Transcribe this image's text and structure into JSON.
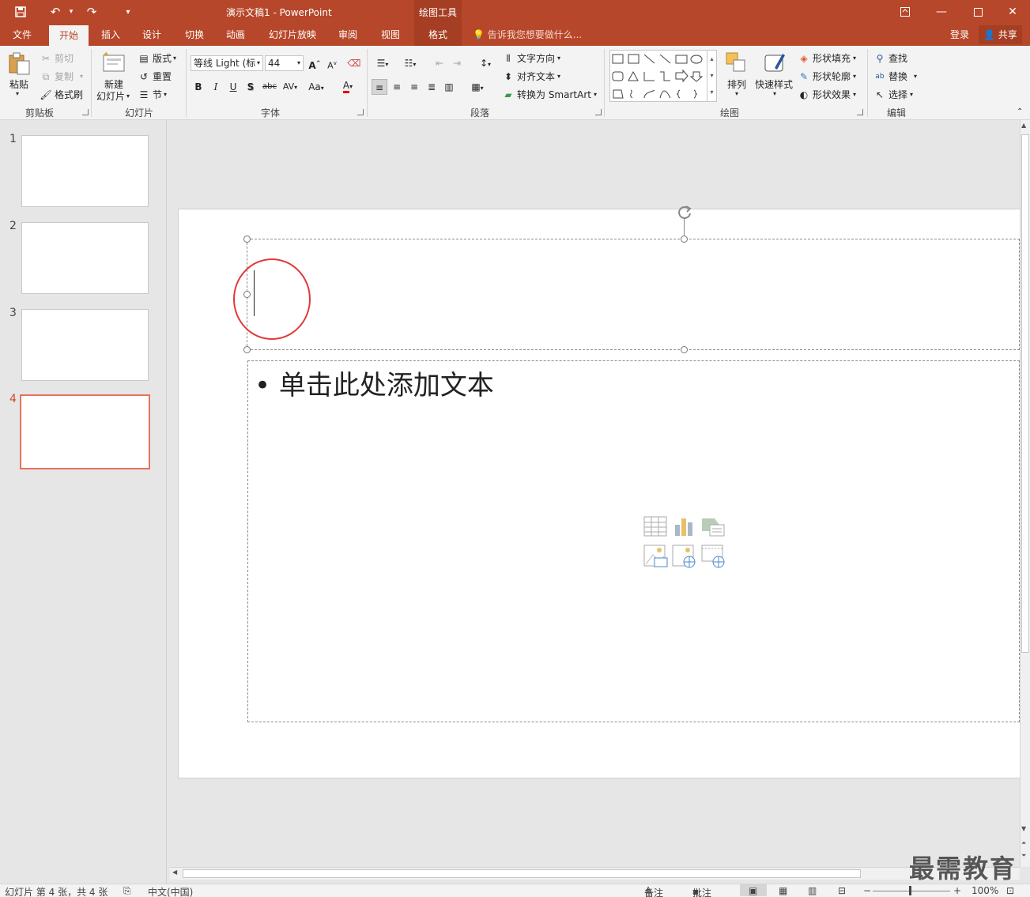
{
  "window": {
    "title": "演示文稿1 - PowerPoint",
    "context_tools": "绘图工具"
  },
  "tabs": {
    "file": "文件",
    "home": "开始",
    "insert": "插入",
    "design": "设计",
    "transitions": "切换",
    "animations": "动画",
    "slideshow": "幻灯片放映",
    "review": "审阅",
    "view": "视图",
    "format": "格式",
    "tell_me": "告诉我您想要做什么...",
    "login": "登录",
    "share": "共享"
  },
  "ribbon": {
    "clipboard": {
      "label": "剪贴板",
      "paste": "粘贴",
      "cut": "剪切",
      "copy": "复制",
      "format_painter": "格式刷"
    },
    "slides": {
      "label": "幻灯片",
      "new_slide_1": "新建",
      "new_slide_2": "幻灯片",
      "layout": "版式",
      "reset": "重置",
      "section": "节"
    },
    "font": {
      "label": "字体",
      "font_name": "等线 Light (标",
      "font_size": "44",
      "bold": "B",
      "italic": "I",
      "underline": "U",
      "shadow": "S",
      "strike": "abc",
      "spacing": "AV",
      "case": "Aa",
      "color": "A",
      "grow": "A",
      "shrink": "A"
    },
    "paragraph": {
      "label": "段落",
      "text_direction": "文字方向",
      "align_text": "对齐文本",
      "smartart": "转换为 SmartArt"
    },
    "drawing": {
      "label": "绘图",
      "arrange": "排列",
      "quick_styles": "快速样式",
      "shape_fill": "形状填充",
      "shape_outline": "形状轮廓",
      "shape_effects": "形状效果"
    },
    "editing": {
      "label": "编辑",
      "find": "查找",
      "replace": "替换",
      "select": "选择"
    }
  },
  "slides_panel": {
    "items": [
      {
        "number": "1",
        "active": false
      },
      {
        "number": "2",
        "active": false
      },
      {
        "number": "3",
        "active": false
      },
      {
        "number": "4",
        "active": true
      }
    ]
  },
  "slide": {
    "content_placeholder": "• 单击此处添加文本"
  },
  "statusbar": {
    "slide_info": "幻灯片 第 4 张，共 4 张",
    "language": "中文(中国)",
    "notes": "备注",
    "comments": "批注",
    "zoom": "100%"
  },
  "watermark": "最需教育",
  "colors": {
    "accent": "#b7472a",
    "active_thumb": "#e8735a",
    "annotation_circle": "#e03a3a"
  }
}
